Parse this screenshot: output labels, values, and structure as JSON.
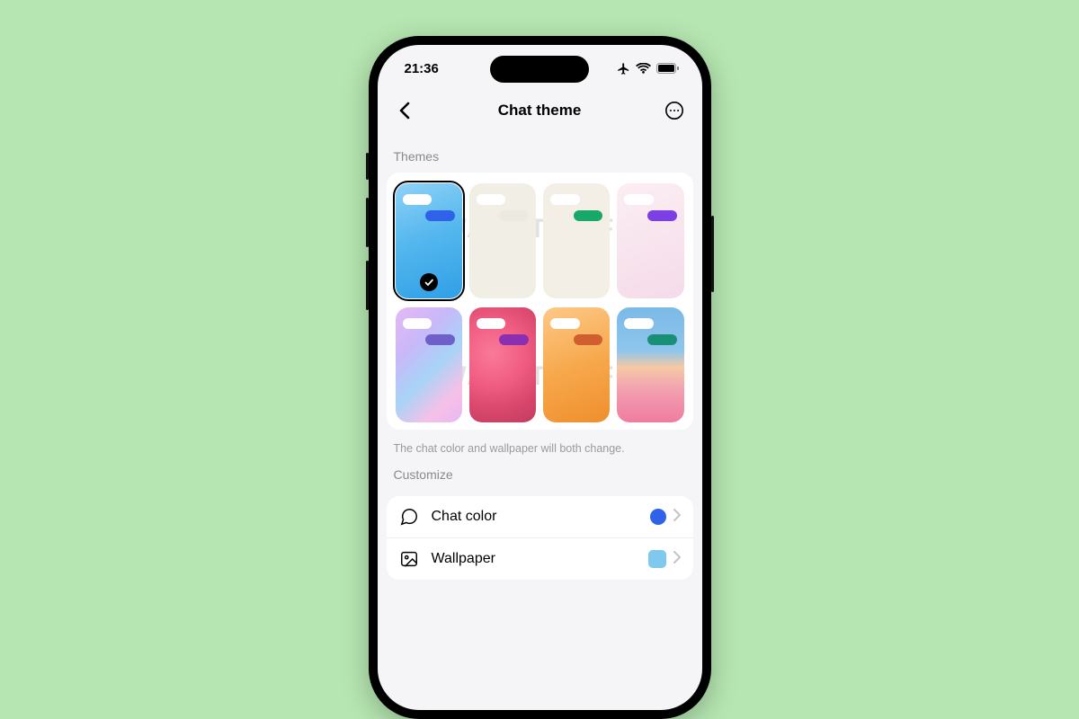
{
  "status": {
    "time": "21:36"
  },
  "nav": {
    "title": "Chat theme"
  },
  "sections": {
    "themes_label": "Themes",
    "customize_label": "Customize"
  },
  "hint": "The chat color and wallpaper will both change.",
  "themes": [
    {
      "name": "sky",
      "bg_class": "bg-sky",
      "bubble_color": "#2f62e8",
      "selected": true
    },
    {
      "name": "cream",
      "bg_class": "bg-cream",
      "bubble_color": "#eceadf",
      "selected": false
    },
    {
      "name": "green",
      "bg_class": "bg-cream2",
      "bubble_color": "#17a86a",
      "selected": false
    },
    {
      "name": "violet",
      "bg_class": "bg-pink0",
      "bubble_color": "#7b3fe4",
      "selected": false
    },
    {
      "name": "holo",
      "bg_class": "bg-holo",
      "bubble_color": "#6f5fc9",
      "selected": false
    },
    {
      "name": "coral",
      "bg_class": "bg-coral",
      "bubble_color": "#8a2fb0",
      "selected": false
    },
    {
      "name": "orange",
      "bg_class": "bg-orange",
      "bubble_color": "#cf5f2e",
      "selected": false
    },
    {
      "name": "beach",
      "bg_class": "bg-beach",
      "bubble_color": "#1a8f78",
      "selected": false
    }
  ],
  "customize": {
    "chat_color": {
      "label": "Chat color",
      "swatch": "#2f62e8"
    },
    "wallpaper": {
      "label": "Wallpaper",
      "swatch": "#7fc9ef"
    }
  },
  "watermark": "WABETAINFO"
}
